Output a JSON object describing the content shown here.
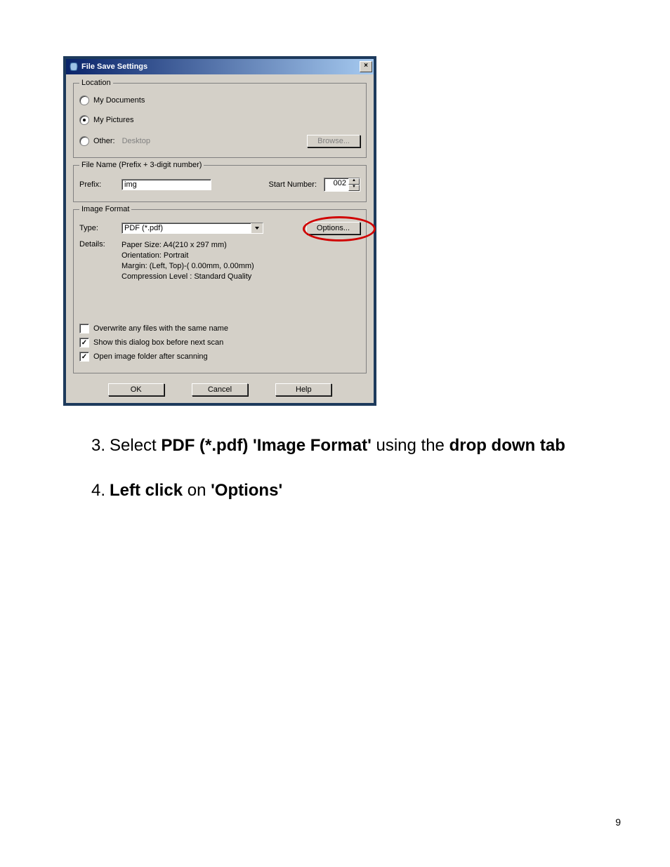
{
  "dialog": {
    "title": "File Save Settings",
    "location": {
      "legend": "Location",
      "my_documents": "My Documents",
      "my_pictures": "My Pictures",
      "other_label": "Other:",
      "other_value": "Desktop",
      "browse_label": "Browse..."
    },
    "filename": {
      "legend": "File Name (Prefix + 3-digit number)",
      "prefix_label": "Prefix:",
      "prefix_value": "img",
      "start_label": "Start Number:",
      "start_value": "002"
    },
    "image_format": {
      "legend": "Image Format",
      "type_label": "Type:",
      "type_value": "PDF (*.pdf)",
      "options_label": "Options...",
      "details_label": "Details:",
      "details_lines": [
        "Paper Size: A4(210 x 297 mm)",
        "Orientation: Portrait",
        "Margin: (Left, Top)-( 0.00mm, 0.00mm)",
        "Compression Level : Standard Quality"
      ]
    },
    "check_overwrite": "Overwrite any files with the same name",
    "check_show_dialog": "Show this dialog box before next scan",
    "check_open_folder": "Open image folder after scanning",
    "ok": "OK",
    "cancel": "Cancel",
    "help": "Help"
  },
  "instructions": {
    "step3": {
      "num": "3.",
      "t1": "Select ",
      "b1": "PDF (*.pdf) 'Image Format'",
      "t2": " using the ",
      "b2": "drop down tab"
    },
    "step4": {
      "num": "4.",
      "b1": "Left click",
      "t1": " on ",
      "b2": "'Options'"
    }
  },
  "pagenum": "9"
}
